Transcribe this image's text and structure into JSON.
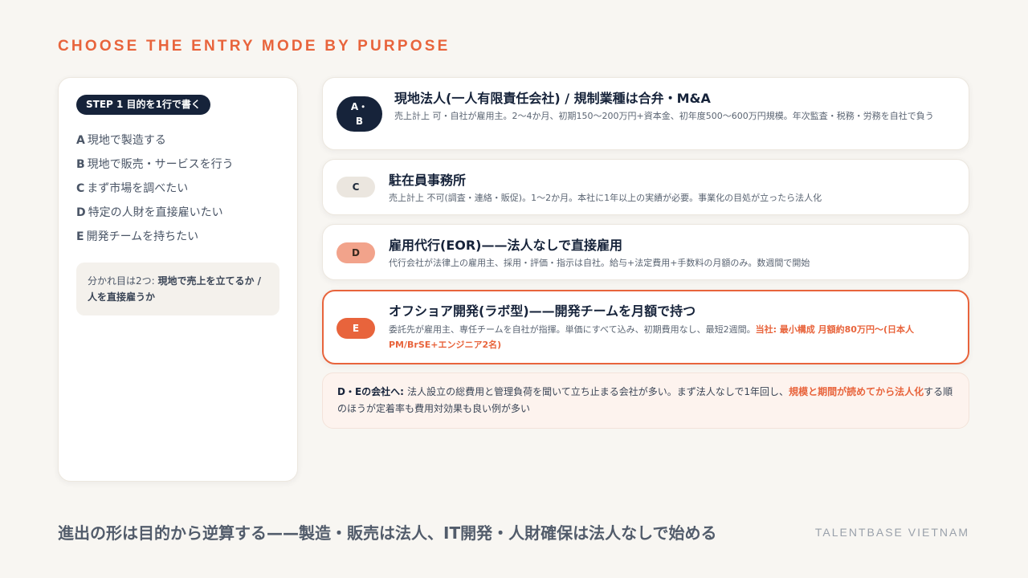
{
  "eyebrow": "CHOOSE THE ENTRY MODE BY PURPOSE",
  "left_panel": {
    "step_label": "STEP 1 目的を1行で書く",
    "purposes": [
      {
        "letter": "A",
        "text": "現地で製造する"
      },
      {
        "letter": "B",
        "text": "現地で販売・サービスを行う"
      },
      {
        "letter": "C",
        "text": "まず市場を調べたい"
      },
      {
        "letter": "D",
        "text": "特定の人財を直接雇いたい"
      },
      {
        "letter": "E",
        "text": "開発チームを持ちたい"
      }
    ],
    "note_prefix": "分かれ目は2つ: ",
    "note_bold": "現地で売上を立てるか / 人を直接雇うか"
  },
  "modes": [
    {
      "badge_line1": "A・",
      "badge_line2": "B",
      "title": "現地法人(一人有限責任会社) / 規制業種は合弁・M&A",
      "desc": "売上計上 可・自社が雇用主。2〜4か月、初期150〜200万円+資本金、初年度500〜600万円規模。年次監査・税務・労務を自社で負う"
    },
    {
      "badge": "C",
      "title": "駐在員事務所",
      "desc": "売上計上 不可(調査・連絡・販促)。1〜2か月。本社に1年以上の実績が必要。事業化の目処が立ったら法人化"
    },
    {
      "badge": "D",
      "title": "雇用代行(EOR)——法人なしで直接雇用",
      "desc": "代行会社が法律上の雇用主、採用・評価・指示は自社。給与+法定費用+手数料の月額のみ。数週間で開始"
    },
    {
      "badge": "E",
      "title": "オフショア開発(ラボ型)——開発チームを月額で持つ",
      "desc": "委託先が雇用主、専任チームを自社が指揮。単価にすべて込み、初期費用なし、最短2週間。",
      "desc_accent": "当社: 最小構成 月額約80万円〜(日本人PM/BrSE+エンジニア2名)"
    }
  ],
  "callout": {
    "bold": "D・Eの会社へ: ",
    "text1": "法人設立の総費用と管理負荷を聞いて立ち止まる会社が多い。まず法人なしで1年回し、",
    "accent": "規模と期間が読めてから法人化",
    "text2": "する順のほうが定着率も費用対効果も良い例が多い"
  },
  "footer": {
    "title": "進出の形は目的から逆算する——製造・販売は法人、IT開発・人財確保は法人なしで始める",
    "brand": "TALENTBASE VIETNAM"
  },
  "colors": {
    "accent": "#e8643c",
    "navy": "#16233a",
    "background": "#f8f6f2"
  }
}
